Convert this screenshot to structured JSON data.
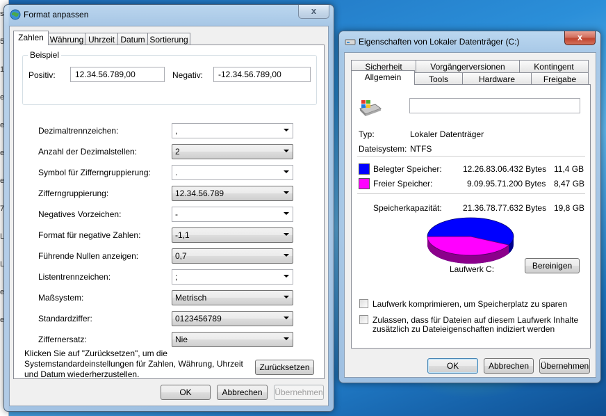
{
  "background": {
    "desktop_colors": {
      "blue": "#1d6bb8",
      "glow": "#bee650"
    },
    "left_strip_text": [
      "s",
      "5",
      "1",
      "e",
      "e",
      "e",
      "e",
      "7",
      "L",
      "L",
      "e",
      "e"
    ]
  },
  "format_dialog": {
    "title": "Format anpassen",
    "close_label": "x",
    "tabs": [
      "Zahlen",
      "Währung",
      "Uhrzeit",
      "Datum",
      "Sortierung"
    ],
    "active_tab": "Zahlen",
    "example": {
      "group_label": "Beispiel",
      "positive_label": "Positiv:",
      "positive_value": "12.34.56.789,00",
      "negative_label": "Negativ:",
      "negative_value": "-12.34.56.789,00"
    },
    "settings": [
      {
        "label": "Dezimaltrennzeichen:",
        "value": ",",
        "kind": "editable"
      },
      {
        "label": "Anzahl der Dezimalstellen:",
        "value": "2",
        "kind": "list"
      },
      {
        "label": "Symbol für Zifferngruppierung:",
        "value": ".",
        "kind": "editable"
      },
      {
        "label": "Zifferngruppierung:",
        "value": "12.34.56.789",
        "kind": "list"
      },
      {
        "label": "Negatives Vorzeichen:",
        "value": "-",
        "kind": "editable"
      },
      {
        "label": "Format für negative Zahlen:",
        "value": "-1,1",
        "kind": "list"
      },
      {
        "label": "Führende Nullen anzeigen:",
        "value": "0,7",
        "kind": "list"
      },
      {
        "label": "Listentrennzeichen:",
        "value": ";",
        "kind": "editable"
      },
      {
        "label": "Maßsystem:",
        "value": "Metrisch",
        "kind": "list"
      },
      {
        "label": "Standardziffer:",
        "value": "0123456789",
        "kind": "list"
      },
      {
        "label": "Ziffernersatz:",
        "value": "Nie",
        "kind": "list"
      }
    ],
    "reset_info": "Klicken Sie auf \"Zurücksetzen\", um die Systemstandardeinstellungen für Zahlen, Währung, Uhrzeit und Datum wiederherzustellen.",
    "reset_button": "Zurücksetzen",
    "ok": "OK",
    "cancel": "Abbrechen",
    "apply": "Übernehmen"
  },
  "drive_dialog": {
    "title": "Eigenschaften von Lokaler Datenträger (C:)",
    "close_label": "x",
    "tabs_back": [
      "Sicherheit",
      "Vorgängerversionen",
      "Kontingent"
    ],
    "tabs_front": [
      "Allgemein",
      "Tools",
      "Hardware",
      "Freigabe"
    ],
    "active_tab": "Allgemein",
    "name_value": "",
    "type_label": "Typ:",
    "type_value": "Lokaler Datenträger",
    "fs_label": "Dateisystem:",
    "fs_value": "NTFS",
    "used": {
      "label": "Belegter Speicher:",
      "bytes": "12.26.83.06.432 Bytes",
      "size": "11,4 GB",
      "color": "#0000ff"
    },
    "free": {
      "label": "Freier Speicher:",
      "bytes": "9.09.95.71.200 Bytes",
      "size": "8,47 GB",
      "color": "#ff00ff"
    },
    "capacity": {
      "label": "Speicherkapazität:",
      "bytes": "21.36.78.77.632 Bytes",
      "size": "19,8 GB"
    },
    "pie_used_fraction": 0.576,
    "drive_label": "Laufwerk C:",
    "cleanup_button": "Bereinigen",
    "compress_label": "Laufwerk komprimieren, um Speicherplatz zu sparen",
    "compress_checked": false,
    "index_label_line1": "Zulassen, dass für Dateien auf diesem Laufwerk Inhalte",
    "index_label_line2": "zusätzlich zu Dateieigenschaften indiziert werden",
    "index_checked": false,
    "ok": "OK",
    "cancel": "Abbrechen",
    "apply": "Übernehmen"
  }
}
